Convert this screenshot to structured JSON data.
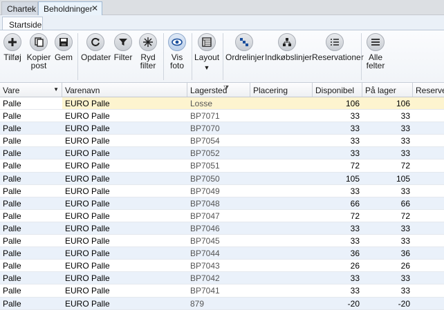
{
  "doc_tabs": [
    {
      "label": "Chartek"
    },
    {
      "label": "Beholdninger"
    }
  ],
  "ribbon": {
    "tab": "Startside",
    "buttons": {
      "add": "Tilføj",
      "copy": "Kopier post",
      "save": "Gem",
      "refresh": "Opdater",
      "filter": "Filter",
      "clear_filter": "Ryd filter",
      "show_photo": "Vis foto",
      "layout": "Layout",
      "order_lines": "Ordrelinjer",
      "purchase_lines": "Indkøbslinjer",
      "reservations": "Reservationer",
      "all_fields": "Alle felter"
    }
  },
  "grid": {
    "columns": {
      "vare": "Vare",
      "varenavn": "Varenavn",
      "lagersted": "Lagersted",
      "placering": "Placering",
      "disponibel": "Disponibel",
      "paa_lager": "På lager",
      "reserveret": "Reserver"
    },
    "rows": [
      {
        "vare": "Palle",
        "varenavn": "EURO Palle",
        "lagersted": "Losse",
        "disponibel": "106",
        "paa_lager": "106"
      },
      {
        "vare": "Palle",
        "varenavn": "EURO Palle",
        "lagersted": "BP7071",
        "disponibel": "33",
        "paa_lager": "33"
      },
      {
        "vare": "Palle",
        "varenavn": "EURO Palle",
        "lagersted": "BP7070",
        "disponibel": "33",
        "paa_lager": "33"
      },
      {
        "vare": "Palle",
        "varenavn": "EURO Palle",
        "lagersted": "BP7054",
        "disponibel": "33",
        "paa_lager": "33"
      },
      {
        "vare": "Palle",
        "varenavn": "EURO Palle",
        "lagersted": "BP7052",
        "disponibel": "33",
        "paa_lager": "33"
      },
      {
        "vare": "Palle",
        "varenavn": "EURO Palle",
        "lagersted": "BP7051",
        "disponibel": "72",
        "paa_lager": "72"
      },
      {
        "vare": "Palle",
        "varenavn": "EURO Palle",
        "lagersted": "BP7050",
        "disponibel": "105",
        "paa_lager": "105"
      },
      {
        "vare": "Palle",
        "varenavn": "EURO Palle",
        "lagersted": "BP7049",
        "disponibel": "33",
        "paa_lager": "33"
      },
      {
        "vare": "Palle",
        "varenavn": "EURO Palle",
        "lagersted": "BP7048",
        "disponibel": "66",
        "paa_lager": "66"
      },
      {
        "vare": "Palle",
        "varenavn": "EURO Palle",
        "lagersted": "BP7047",
        "disponibel": "72",
        "paa_lager": "72"
      },
      {
        "vare": "Palle",
        "varenavn": "EURO Palle",
        "lagersted": "BP7046",
        "disponibel": "33",
        "paa_lager": "33"
      },
      {
        "vare": "Palle",
        "varenavn": "EURO Palle",
        "lagersted": "BP7045",
        "disponibel": "33",
        "paa_lager": "33"
      },
      {
        "vare": "Palle",
        "varenavn": "EURO Palle",
        "lagersted": "BP7044",
        "disponibel": "36",
        "paa_lager": "36"
      },
      {
        "vare": "Palle",
        "varenavn": "EURO Palle",
        "lagersted": "BP7043",
        "disponibel": "26",
        "paa_lager": "26"
      },
      {
        "vare": "Palle",
        "varenavn": "EURO Palle",
        "lagersted": "BP7042",
        "disponibel": "33",
        "paa_lager": "33"
      },
      {
        "vare": "Palle",
        "varenavn": "EURO Palle",
        "lagersted": "BP7041",
        "disponibel": "33",
        "paa_lager": "33"
      },
      {
        "vare": "Palle",
        "varenavn": "EURO Palle",
        "lagersted": "879",
        "disponibel": "-20",
        "paa_lager": "-20"
      }
    ],
    "selected_row": 0
  }
}
